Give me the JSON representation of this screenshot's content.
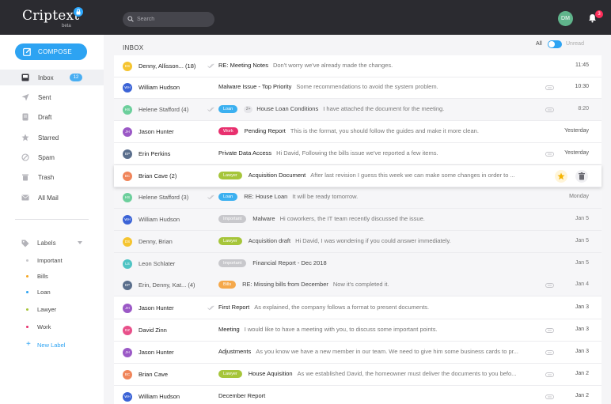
{
  "app": {
    "logo": "Criptext",
    "beta": "beta"
  },
  "search": {
    "placeholder": "Search"
  },
  "user": {
    "initials": "DM",
    "notifications": "3"
  },
  "sidebar": {
    "compose_label": "COMPOSE",
    "items": [
      {
        "label": "Inbox",
        "count": "12"
      },
      {
        "label": "Sent"
      },
      {
        "label": "Draft"
      },
      {
        "label": "Starred"
      },
      {
        "label": "Spam"
      },
      {
        "label": "Trash"
      },
      {
        "label": "All Mail"
      }
    ],
    "labels_heading": "Labels",
    "labels": [
      {
        "name": "Important",
        "color": "#c8c8cc"
      },
      {
        "name": "Bills",
        "color": "#f5a623"
      },
      {
        "name": "Loan",
        "color": "#2da3f2"
      },
      {
        "name": "Lawyer",
        "color": "#a6c53a"
      },
      {
        "name": "Work",
        "color": "#e8306e"
      }
    ],
    "new_label": "New Label"
  },
  "main": {
    "title": "INBOX",
    "filter_all": "All",
    "filter_unread": "Unread"
  },
  "emails": [
    {
      "initials": "DS",
      "avatar_color": "#f5c430",
      "from": "Denny, Allisson... (18)",
      "tag": "",
      "count": "",
      "subject": "RE: Meeting Notes",
      "preview": "Don't worry we've already made the changes.",
      "date": "11:45",
      "read": false,
      "attach": false,
      "check": true
    },
    {
      "initials": "WH",
      "avatar_color": "#3b63d6",
      "from": "William Hudson",
      "tag": "",
      "count": "",
      "subject": "Malware Issue - Top Priority",
      "preview": "Some recommendations to avoid the system problem.",
      "date": "10:30",
      "read": false,
      "attach": true,
      "check": false
    },
    {
      "initials": "HS",
      "avatar_color": "#6ccf9c",
      "from": "Helene Stafford (4)",
      "tag": "Loan",
      "count": "2+",
      "subject": "House Loan Conditions",
      "preview": "I have attached the document for the meeting.",
      "date": "8:20",
      "read": true,
      "attach": true,
      "check": true
    },
    {
      "initials": "JH",
      "avatar_color": "#9b59c6",
      "from": "Jason Hunter",
      "tag": "Work",
      "count": "",
      "subject": "Pending Report",
      "preview": "This is the format, you should follow the guides and make it more clean.",
      "date": "Yesterday",
      "read": false,
      "attach": false,
      "check": false
    },
    {
      "initials": "EP",
      "avatar_color": "#5a6e8c",
      "from": "Erin Perkins",
      "tag": "",
      "count": "",
      "subject": "Private Data Access",
      "preview": "Hi David, Following the bills issue we've reported a few items.",
      "date": "Yesterday",
      "read": false,
      "attach": true,
      "check": false
    },
    {
      "initials": "BC",
      "avatar_color": "#f0855a",
      "from": "Brian Cave (2)",
      "tag": "Lawyer",
      "count": "",
      "subject": "Acquisition Document",
      "preview": "After last revision I guess this week we can make some changes in order to ...",
      "date": "",
      "read": false,
      "attach": false,
      "check": false
    },
    {
      "initials": "HS",
      "avatar_color": "#6ccf9c",
      "from": "Helene Stafford (3)",
      "tag": "Loan",
      "count": "",
      "subject": "RE: House Loan",
      "preview": "It will be ready tomorrow.",
      "date": "Monday",
      "read": true,
      "attach": false,
      "check": true
    },
    {
      "initials": "WH",
      "avatar_color": "#3b63d6",
      "from": "William Hudson",
      "tag": "Important",
      "count": "",
      "subject": "Malware",
      "preview": "Hi coworkers, the IT team recently discussed the issue.",
      "date": "Jan 5",
      "read": true,
      "attach": false,
      "check": false
    },
    {
      "initials": "DS",
      "avatar_color": "#f5c430",
      "from": "Denny, Brian",
      "tag": "Lawyer",
      "count": "",
      "subject": "Acquisition draft",
      "preview": "Hi David, I was wondering if you could answer immediately.",
      "date": "Jan 5",
      "read": true,
      "attach": false,
      "check": false
    },
    {
      "initials": "LS",
      "avatar_color": "#4fc4c4",
      "from": "Leon Schlater",
      "tag": "Important",
      "count": "",
      "subject": "Financial Report - Dec 2018",
      "preview": "",
      "date": "Jan 5",
      "read": true,
      "attach": false,
      "check": false
    },
    {
      "initials": "EP",
      "avatar_color": "#5a6e8c",
      "from": "Erin, Denny, Kat... (4)",
      "tag": "Bills",
      "count": "",
      "subject": "RE: Missing bills from December",
      "preview": "Now it's completed it.",
      "date": "Jan 4",
      "read": true,
      "attach": true,
      "check": false
    },
    {
      "initials": "JH",
      "avatar_color": "#9b59c6",
      "from": "Jason Hunter",
      "tag": "",
      "count": "",
      "subject": "First Report",
      "preview": "As explained, the company follows a format to present documents.",
      "date": "Jan 3",
      "read": false,
      "attach": false,
      "check": true
    },
    {
      "initials": "DZ",
      "avatar_color": "#e8508a",
      "from": "David Zinn",
      "tag": "",
      "count": "",
      "subject": "Meeting",
      "preview": "I would like to have a meeting with you, to discuss some important points.",
      "date": "Jan 3",
      "read": false,
      "attach": true,
      "check": false
    },
    {
      "initials": "JH",
      "avatar_color": "#9b59c6",
      "from": "Jason Hunter",
      "tag": "",
      "count": "",
      "subject": "Adjustments",
      "preview": "As you know we have a new member in our team. We need to give him some business cards to pr...",
      "date": "Jan 3",
      "read": false,
      "attach": true,
      "check": false
    },
    {
      "initials": "BC",
      "avatar_color": "#f0855a",
      "from": "Brian Cave",
      "tag": "Lawyer",
      "count": "",
      "subject": "House Aquisition",
      "preview": "As we established David, the homeowner must deliver the documents to you befo...",
      "date": "Jan 2",
      "read": false,
      "attach": true,
      "check": false
    },
    {
      "initials": "WH",
      "avatar_color": "#3b63d6",
      "from": "William Hudson",
      "tag": "",
      "count": "",
      "subject": "December Report",
      "preview": "",
      "date": "Jan 2",
      "read": false,
      "attach": true,
      "check": false
    }
  ],
  "tag_colors": {
    "Loan": "#3bb0f0",
    "Work": "#e8306e",
    "Lawyer": "#a6c53a",
    "Important": "#c8c8cc",
    "Bills": "#f5a84a"
  },
  "colors": {
    "accent": "#2da3f2",
    "topbar": "#2b2b30"
  }
}
